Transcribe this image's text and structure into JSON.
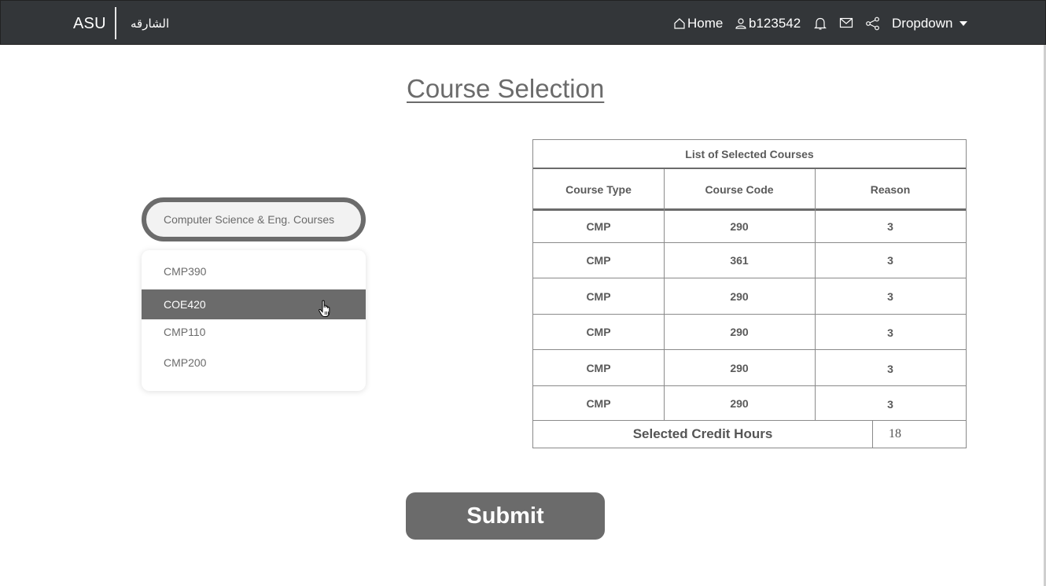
{
  "navbar": {
    "brand": "ASU",
    "brand_arabic": "الشارقه",
    "home_label": "Home",
    "user_label": "b123542",
    "dropdown_label": "Dropdown"
  },
  "page": {
    "title": "Course Selection"
  },
  "course_select": {
    "value": "Computer Science & Eng. Courses",
    "options": [
      "CMP390",
      "COE420",
      "CMP110",
      "CMP200"
    ],
    "highlighted": "COE420"
  },
  "table": {
    "caption": "List of Selected Courses",
    "headers": [
      "Course Type",
      "Course Code",
      "Reason"
    ],
    "rows": [
      [
        "CMP",
        "290",
        "3"
      ],
      [
        "CMP",
        "361",
        "3"
      ],
      [
        "CMP",
        "290",
        "3"
      ],
      [
        "CMP",
        "290",
        "3"
      ],
      [
        "CMP",
        "290",
        "3"
      ],
      [
        "CMP",
        "290",
        "3"
      ]
    ],
    "footer_label": "Selected Credit Hours",
    "footer_value": "18"
  },
  "actions": {
    "submit_label": "Submit"
  },
  "icons": [
    "home-icon",
    "user-icon",
    "bell-icon",
    "mail-icon",
    "share-icon",
    "caret-down-icon",
    "hand-cursor-icon"
  ],
  "colors": {
    "navbar": "#333639",
    "accent_gray": "#6b6b6b",
    "text": "#555555"
  }
}
